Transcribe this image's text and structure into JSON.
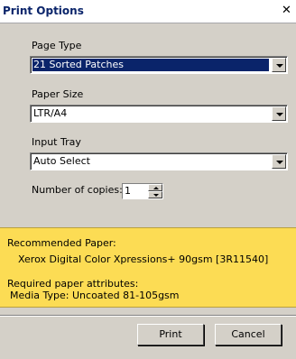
{
  "window": {
    "title": "Print Options",
    "close_glyph": "✕"
  },
  "page_type": {
    "label": "Page Type",
    "value": "21 Sorted Patches"
  },
  "paper_size": {
    "label": "Paper Size",
    "value": "LTR/A4"
  },
  "input_tray": {
    "label": "Input Tray",
    "value": "Auto Select"
  },
  "copies": {
    "label": "Number of copies:",
    "value": "1"
  },
  "info": {
    "recommended_heading": "Recommended Paper:",
    "recommended_value": "Xerox Digital Color Xpressions+ 90gsm [3R11540]",
    "required_heading": "Required paper attributes:",
    "required_value": "Media Type:  Uncoated 81-105gsm"
  },
  "buttons": {
    "print": "Print",
    "cancel": "Cancel"
  },
  "colors": {
    "info_panel": "#fcdc54",
    "selection": "#0a246a",
    "dialog_bg": "#d4d0c8"
  }
}
